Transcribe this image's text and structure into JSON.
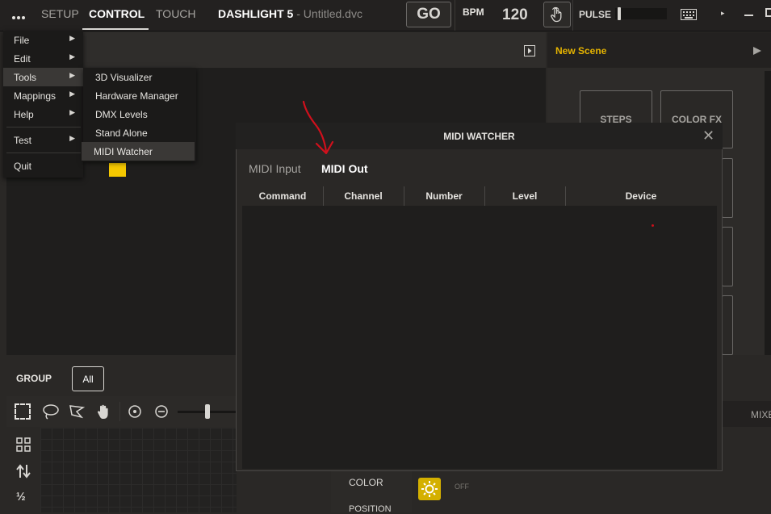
{
  "topbar": {
    "tabs": [
      "SETUP",
      "CONTROL",
      "TOUCH"
    ],
    "active_tab": "CONTROL",
    "app_name": "DASHLIGHT 5",
    "file_sep": " - ",
    "file_name": "Untitled.dvc",
    "go_label": "GO",
    "bpm_label": "BPM",
    "bpm_value": "120",
    "pulse_label": "PULSE"
  },
  "main_menu": {
    "items": [
      "File",
      "Edit",
      "Tools",
      "Mappings",
      "Help",
      "Test",
      "Quit"
    ],
    "highlighted": "Tools"
  },
  "tools_menu": {
    "items": [
      "3D Visualizer",
      "Hardware Manager",
      "DMX Levels",
      "Stand Alone",
      "MIDI Watcher"
    ],
    "highlighted": "MIDI Watcher"
  },
  "right_panel": {
    "title": "New Scene",
    "buttons": [
      "STEPS",
      "COLOR FX"
    ]
  },
  "group_bar": {
    "label": "GROUP",
    "all_button": "All"
  },
  "bottom": {
    "mixer_label": "MIXE",
    "color_label": "COLOR",
    "position_label": "POSITION",
    "off_label": "OFF"
  },
  "midi_watcher": {
    "title": "MIDI WATCHER",
    "close_glyph": "✕",
    "tabs": [
      "MIDI Input",
      "MIDI Out"
    ],
    "active_tab": "MIDI Out",
    "columns": [
      "Command",
      "Channel",
      "Number",
      "Level",
      "Device"
    ],
    "rows": []
  },
  "colors": {
    "accent_yellow": "#e6b400",
    "annotation_red": "#d0101c"
  }
}
